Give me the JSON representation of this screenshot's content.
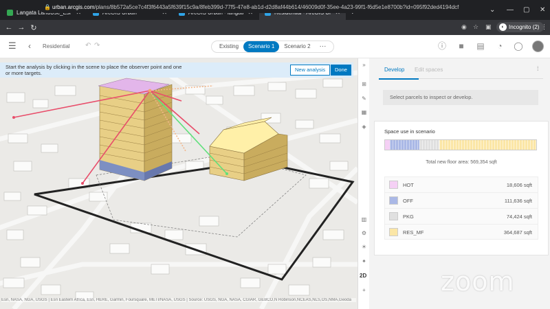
{
  "browser": {
    "tabs": [
      {
        "title": "Langata LandUse_EsriEASTERNA",
        "favcolor": "#34a853"
      },
      {
        "title": "ArcGIS Urban",
        "favcolor": "#2fa4e7"
      },
      {
        "title": "ArcGIS Urban - langata",
        "favcolor": "#2fa4e7"
      },
      {
        "title": "Residential - ArcGIS Urban",
        "favcolor": "#2fa4e7"
      }
    ],
    "address": {
      "host": "urban.arcgis.com",
      "path": "/plans/8b572a5ce7c4f3f6443a5f639f15c9a/8feb399d-77f5-47e8-ab1d-d2d8af44b614/46009d0f-35ee-4a23-99f1-f6d5e1e8700b?id=095f92ded4194dcf9d78764c6f4..."
    },
    "profile_label": "Incognito (2)"
  },
  "app": {
    "breadcrumb": "Residential",
    "scenario_tabs": [
      "Existing",
      "Scenario 1",
      "Scenario 2"
    ],
    "active_scenario": "Scenario 1"
  },
  "map": {
    "notice": "Start the analysis by clicking in the scene to place the observer point and one or more targets.",
    "new_analysis_label": "New analysis",
    "done_label": "Done",
    "attribution": "Esri, NASA, NGA, USGS | Esri Eastern Africa, Esri, HERE, Garmin, Foursquare, METI/NASA, USGS | Source: USGS, NGA, NASA, CGIAR, GEBCO,N Robinson,NCEAS,NLS,OS,NMA,Geoda",
    "view_mode": "2D"
  },
  "panel": {
    "tabs": [
      "Develop",
      "Edit spaces"
    ],
    "select_prompt": "Select parcels to inspect or develop.",
    "chart_title": "Space use in scenario",
    "total_label": "Total new floor area: 569,354 sqft",
    "uses": [
      {
        "name": "HOT",
        "value": "18,606 sqft",
        "sqft": 18606,
        "color": "#f5d0f5"
      },
      {
        "name": "OFF",
        "value": "111,636 sqft",
        "sqft": 111636,
        "color": "#aab8e6"
      },
      {
        "name": "PKG",
        "value": "74,424 sqft",
        "sqft": 74424,
        "color": "#e0e0e0"
      },
      {
        "name": "RES_MF",
        "value": "364,687 sqft",
        "sqft": 364687,
        "color": "#fbe6a6"
      }
    ]
  },
  "overlay": {
    "watermark": "zoom"
  }
}
